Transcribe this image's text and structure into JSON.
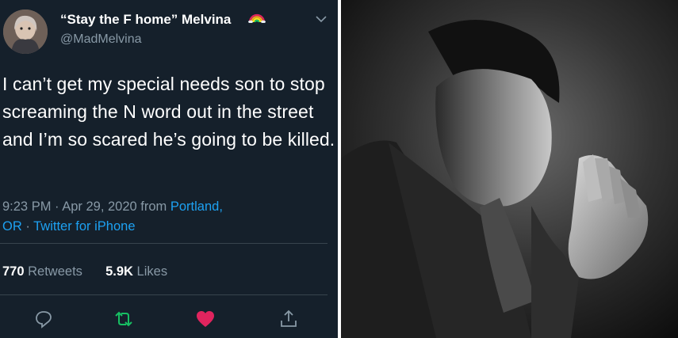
{
  "tweet": {
    "display_name": "“Stay the F home” Melvina",
    "handle": "@MadMelvina",
    "text": "I can’t get my special needs son to stop screaming the N word out in the street and I’m so scared he’s going to be killed.",
    "time_date": "9:23 PM · Apr 29, 2020 from ",
    "location_part1": "Portland,",
    "location_part2": "OR",
    "separator": " · ",
    "source": "Twitter for iPhone",
    "retweets_count": "770",
    "retweets_label": "Retweets",
    "likes_count": "5.9K",
    "likes_label": "Likes",
    "icons": [
      "rainbow-icon",
      "chevron-down-icon",
      "reply-icon",
      "retweet-icon",
      "like-icon",
      "share-icon"
    ]
  },
  "colors": {
    "background": "#15202b",
    "text": "#ffffff",
    "secondary_text": "#8899a6",
    "link": "#1da1f2",
    "retweet_green": "#17bf63",
    "like_red": "#e0245e"
  }
}
